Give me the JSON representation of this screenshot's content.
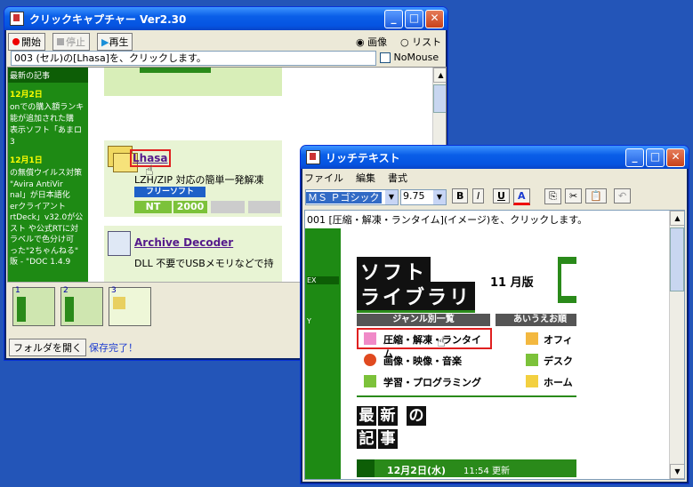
{
  "colors": {
    "desktop": "#2355b8",
    "accent_green": "#2a8a1a",
    "link": "#551a8b",
    "highlight_red": "#e02020"
  },
  "capture_window": {
    "title": "クリックキャプチャー Ver2.30",
    "toolbar": {
      "start": "開始",
      "stop": "停止",
      "play": "再生",
      "mode_image": "画像",
      "mode_list": "リスト"
    },
    "status_line": "003 (セル)の[Lhasa]を、クリックします。",
    "nomouse_label": "NoMouse",
    "page": {
      "sidebar_title": "最新の記事",
      "date1": "12月2日",
      "news1_lines": [
        "onでの購入額ランキ",
        "能が追加された購",
        "表示ソフト「あまロ",
        "3"
      ],
      "date2": "12月1日",
      "news2_lines": [
        "の無償ウイルス対策",
        "\"Avira AntiVir",
        "nal」が日本語化",
        "erクライアント",
        "rtDeck」v32.0が公",
        "スト や公式RTに対",
        "",
        "ラベルで色分け可",
        "った\"2ちゃんねる\"",
        "販 - \"DOC 1.4.9"
      ],
      "item1_title": "Lhasa",
      "item1_desc": "LZH/ZIP 対応の簡単一発解凍",
      "item1_badge": "フリーソフト",
      "item1_os": "NT",
      "item1_os2": "2000",
      "item2_title": "Archive Decoder",
      "item2_desc": "DLL 不要でUSBメモリなどで持"
    },
    "thumbs": [
      "1",
      "2",
      "3"
    ],
    "open_folder": "フォルダを開く",
    "saved_text": "保存完了！"
  },
  "rich_window": {
    "title": "リッチテキスト",
    "menu": [
      "ファイル",
      "編集",
      "書式"
    ],
    "font_name": "ＭＳ Ｐゴシック",
    "font_size": "9.75",
    "fmt": {
      "bold": "B",
      "italic": "I",
      "underline": "U",
      "color": "A"
    },
    "first_line": "001 [圧縮・解凍・ランタイム](イメージ)を、クリックします。",
    "page": {
      "logo_line1": "ソフト",
      "logo_line2": "ライブラリ",
      "edition": "11 月版",
      "genre_header": "ジャンル別一覧",
      "kana_header": "あいうえお順",
      "genres": [
        "圧縮・解凍・ランタイム",
        "画像・映像・音楽",
        "学習・プログラミング"
      ],
      "genres_right": [
        "オフィ",
        "デスク",
        "ホーム"
      ],
      "news_title_chars": [
        "最",
        "新",
        "の",
        "記",
        "事"
      ],
      "news_date": "12月2日(水)",
      "news_time": "11:54 更新",
      "left_strip_label": "EX",
      "left_strip_label2": "Y"
    }
  }
}
